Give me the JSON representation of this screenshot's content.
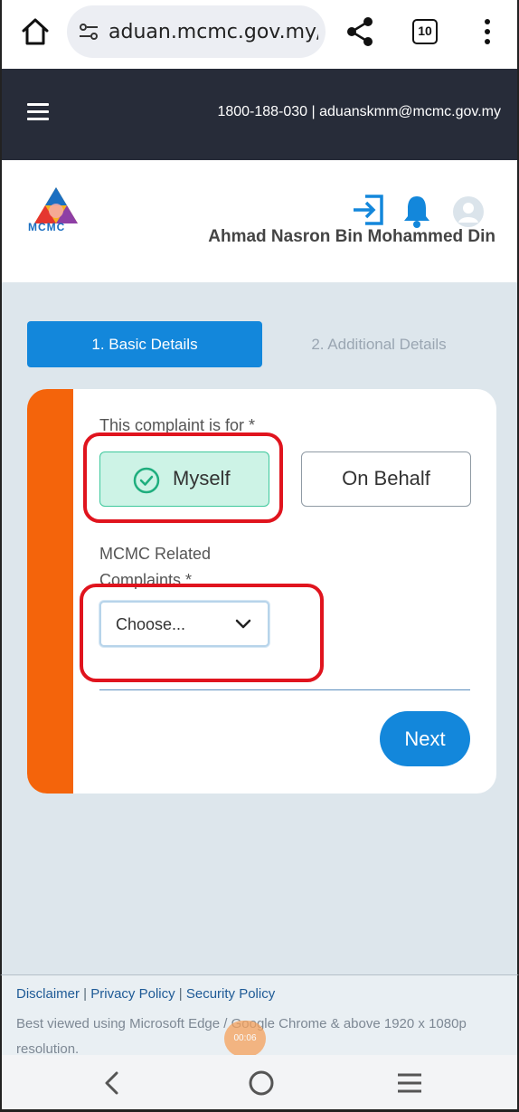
{
  "browser": {
    "url": "aduan.mcmc.gov.my/",
    "tab_count": "10"
  },
  "topbar": {
    "contact": "1800-188-030 | aduanskmm@mcmc.gov.my"
  },
  "header": {
    "logo_text": "MCMC",
    "user_name": "Ahmad Nasron Bin Mohammed Din"
  },
  "steps": [
    {
      "label": "1. Basic Details",
      "active": true
    },
    {
      "label": "2. Additional Details",
      "active": false
    }
  ],
  "form": {
    "complaint_for_label": "This complaint is for *",
    "options": [
      "Myself",
      "On Behalf"
    ],
    "selected_option": "Myself",
    "related_label": "MCMC Related Complaints *",
    "select_value": "Choose...",
    "next_label": "Next"
  },
  "footer": {
    "links": [
      "Disclaimer",
      "Privacy Policy",
      "Security Policy"
    ],
    "separator": " | ",
    "note": "Best viewed using Microsoft Edge / Google Chrome & above 1920 x 1080p resolution.",
    "toast": "00:06"
  },
  "colors": {
    "primary": "#1387db",
    "accent": "#f4640b",
    "selected_bg": "#cdf3e6",
    "selected_border": "#3dc89c",
    "annotation": "#e0141e",
    "header_dark": "#272c39"
  },
  "icons": {
    "home": "home-icon",
    "tune": "tune-icon",
    "share": "share-icon",
    "tabs": "tabs-icon",
    "menu": "more-vert-icon",
    "hamburger": "hamburger-icon",
    "login": "login-icon",
    "bell": "bell-icon",
    "avatar": "avatar-icon",
    "check": "check-circle-icon",
    "chevron": "chevron-down-icon",
    "back": "back-icon",
    "nav_home": "nav-home-icon",
    "recent": "recent-apps-icon"
  }
}
